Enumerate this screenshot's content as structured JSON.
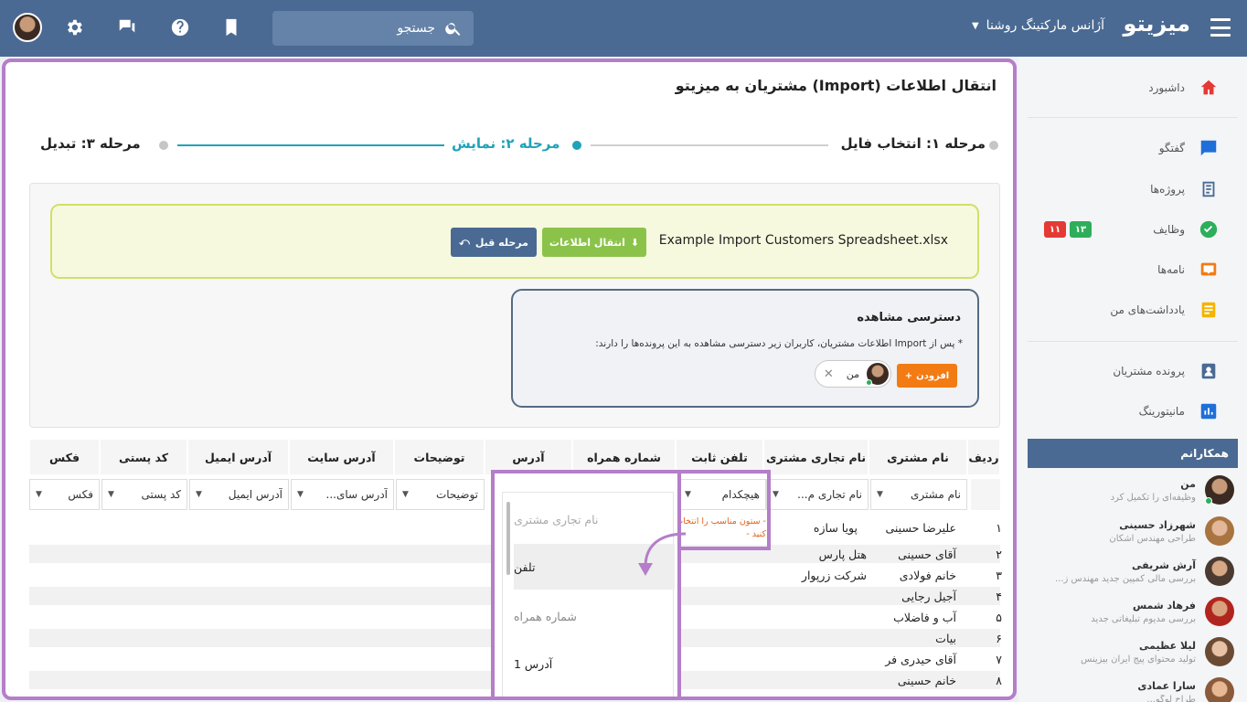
{
  "topbar": {
    "brand": "میزیتو",
    "agency": "آژانس مارکتینگ روشنا",
    "search_placeholder": "جستجو"
  },
  "sidebar": {
    "nav": [
      {
        "label": "داشبورد",
        "icon": "home-icon",
        "color": "#e53935"
      },
      {
        "label": "گفتگو",
        "icon": "chat-icon",
        "color": "#1e6fd9"
      },
      {
        "label": "پروژه‌ها",
        "icon": "projects-icon",
        "color": "#4a6a93"
      },
      {
        "label": "وظایف",
        "icon": "check-circle-icon",
        "color": "#2eae5b"
      },
      {
        "label": "نامه‌ها",
        "icon": "letter-icon",
        "color": "#f27b13"
      },
      {
        "label": "یادداشت‌های من",
        "icon": "note-icon",
        "color": "#f5b400"
      },
      {
        "label": "پرونده مشتریان",
        "icon": "customer-file-icon",
        "color": "#4a6a93"
      },
      {
        "label": "مانیتورینگ",
        "icon": "chart-icon",
        "color": "#1e6fd9"
      }
    ],
    "task_badges": [
      {
        "value": "۱۱",
        "color": "#e53935"
      },
      {
        "value": "۱۳",
        "color": "#2eae5b"
      }
    ],
    "colleagues_title": "همکارانم",
    "colleagues": [
      {
        "name": "من",
        "role": "وظیفه‌ای را تکمیل کرد"
      },
      {
        "name": "شهرزاد حسینی",
        "role": "طراحی مهندس اشکان"
      },
      {
        "name": "آرش شریفی",
        "role": "بررسی مالی کمپین جدید مهندس ز..."
      },
      {
        "name": "فرهاد شمس",
        "role": "بررسی مدیوم تبلیغاتی جدید"
      },
      {
        "name": "لیلا عظیمی",
        "role": "تولید محتوای پیج ایران بیزینس"
      },
      {
        "name": "سارا عمادی",
        "role": "طراح لوگو..."
      }
    ]
  },
  "main": {
    "title": "انتقال اطلاعات (Import) مشتریان به میزیتو",
    "steps": {
      "step1": "مرحله ۱: انتخاب فایل",
      "step2": "مرحله ۲: نمایش",
      "step3": "مرحله ۳: تبدیل"
    },
    "file_name": "Example Import Customers Spreadsheet.xlsx",
    "import_button": "انتقال اطلاعات",
    "prev_button": "مرحله قبل",
    "access": {
      "title": "دسترسی مشاهده",
      "note": "* پس از Import اطلاعات مشتریان، کاربران زیر دسترسی مشاهده به این پرونده‌ها را دارند:",
      "add_button": "افزودن",
      "user_chip": "من"
    },
    "table": {
      "headers": [
        "ردیف",
        "نام مشتری",
        "نام تجاری مشتری",
        "تلفن ثابت",
        "شماره همراه",
        "آدرس",
        "توضیحات",
        "آدرس سایت",
        "آدرس ایمیل",
        "کد پستی",
        "فکس"
      ],
      "mapping": [
        "نام مشتری",
        "نام تجاری م...",
        "هیچکدام",
        "توضیحات",
        "آدرس سای...",
        "آدرس ایمیل",
        "کد پستی",
        "فکس"
      ],
      "mapping_hint": "- ستون مناسب را انتخاب کنید -",
      "rows": [
        {
          "num": "۱",
          "name": "علیرضا حسینی",
          "company": "پویا سازه"
        },
        {
          "num": "۲",
          "name": "آقای حسینی",
          "company": "هتل پارس"
        },
        {
          "num": "۳",
          "name": "خانم فولادی",
          "company": "شرکت زرپوار"
        },
        {
          "num": "۴",
          "name": "آجیل رجایی",
          "company": ""
        },
        {
          "num": "۵",
          "name": "آب و فاضلاب",
          "company": ""
        },
        {
          "num": "۶",
          "name": "بیات",
          "company": ""
        },
        {
          "num": "۷",
          "name": "آقای حیدری فر",
          "company": ""
        },
        {
          "num": "۸",
          "name": "خانم حسینی",
          "company": ""
        }
      ]
    },
    "dropdown": {
      "options": [
        "نام تجاری مشتری",
        "تلفن",
        "شماره همراه",
        "آدرس 1"
      ]
    }
  },
  "colors": {
    "topbar": "#4a6a93",
    "accent_step": "#1fa3b8",
    "highlight_border": "#b47ec9",
    "import_green": "#8bc34a",
    "add_orange": "#f27b13"
  }
}
